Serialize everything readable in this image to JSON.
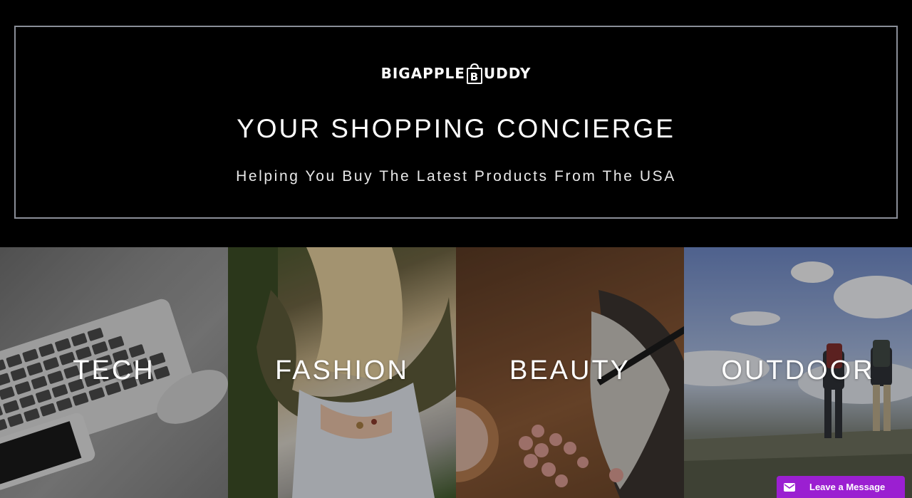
{
  "header": {
    "logo_left": "BIGAPPLE",
    "logo_right": "UDDY",
    "title": "YOUR SHOPPING CONCIERGE",
    "subtitle": "Helping You Buy The Latest Products From The USA"
  },
  "categories": [
    {
      "label": "TECH"
    },
    {
      "label": "FASHION"
    },
    {
      "label": "BEAUTY"
    },
    {
      "label": "OUTDOOR"
    }
  ],
  "chat": {
    "label": "Leave a Message",
    "icon": "envelope-icon",
    "color": "#9b1fd1"
  },
  "colors": {
    "background": "#000000",
    "border": "#8a8e98",
    "text": "#ffffff"
  }
}
